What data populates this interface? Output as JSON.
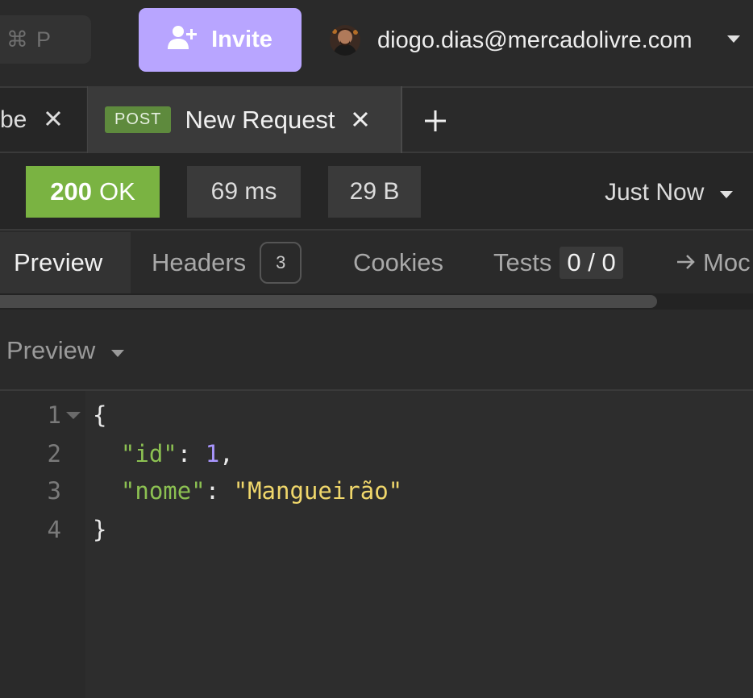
{
  "topbar": {
    "shortcut": {
      "symbol": "⌘",
      "key": "P"
    },
    "invite_label": "Invite",
    "user_email": "diogo.dias@mercadolivre.com"
  },
  "tabs": [
    {
      "label": "be",
      "method": ""
    },
    {
      "label": "New Request",
      "method": "POST",
      "active": true
    }
  ],
  "status": {
    "code": "200",
    "text": "OK",
    "time": "69 ms",
    "size": "29 B",
    "history": "Just Now",
    "color": "#7ab342"
  },
  "response_tabs": {
    "preview": "Preview",
    "headers": "Headers",
    "headers_count": "3",
    "cookies": "Cookies",
    "tests": "Tests",
    "tests_count": "0 / 0",
    "mock": "Moc"
  },
  "preview_mode": "Preview",
  "code": {
    "line_numbers": [
      "1",
      "2",
      "3",
      "4"
    ],
    "open_brace": "{",
    "id_key": "\"id\"",
    "id_value": "1",
    "nome_key": "\"nome\"",
    "nome_value": "\"Mangueirão\"",
    "close_brace": "}",
    "colon": ": ",
    "comma": ","
  },
  "colors": {
    "accent": "#b8a5ff",
    "method_badge": "#5e8a3d",
    "json_key": "#8cc152",
    "json_number": "#a996ff",
    "json_string": "#f0d76b"
  }
}
